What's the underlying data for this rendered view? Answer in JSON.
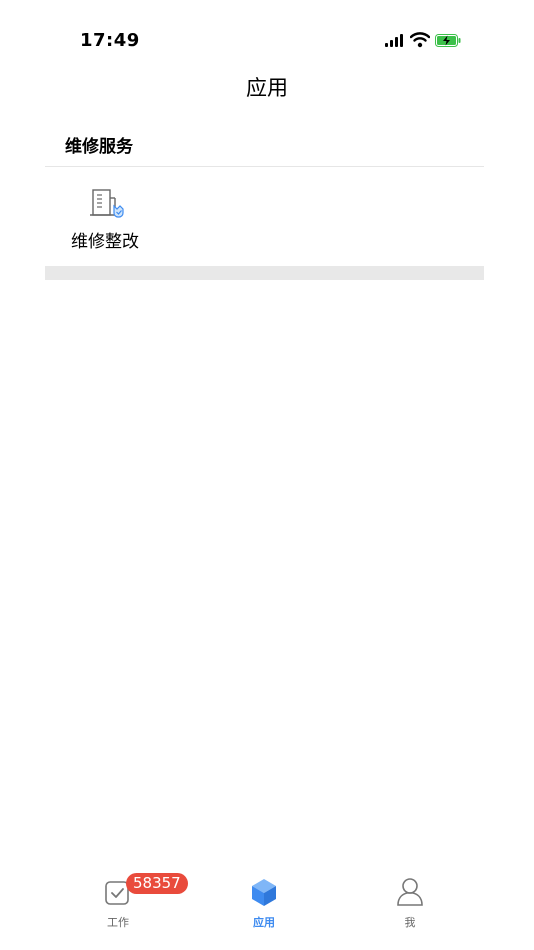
{
  "status_bar": {
    "time": "17:49"
  },
  "nav": {
    "title": "应用"
  },
  "section": {
    "title": "维修服务"
  },
  "apps": [
    {
      "label": "维修整改",
      "icon": "building-repair-icon"
    }
  ],
  "tabs": [
    {
      "label": "工作",
      "icon": "task-check-icon",
      "badge": "58357"
    },
    {
      "label": "应用",
      "icon": "cube-icon"
    },
    {
      "label": "我",
      "icon": "person-icon"
    }
  ],
  "colors": {
    "accent": "#3e8bf0",
    "badge": "#e94b3c",
    "battery": "#3cc04a"
  }
}
